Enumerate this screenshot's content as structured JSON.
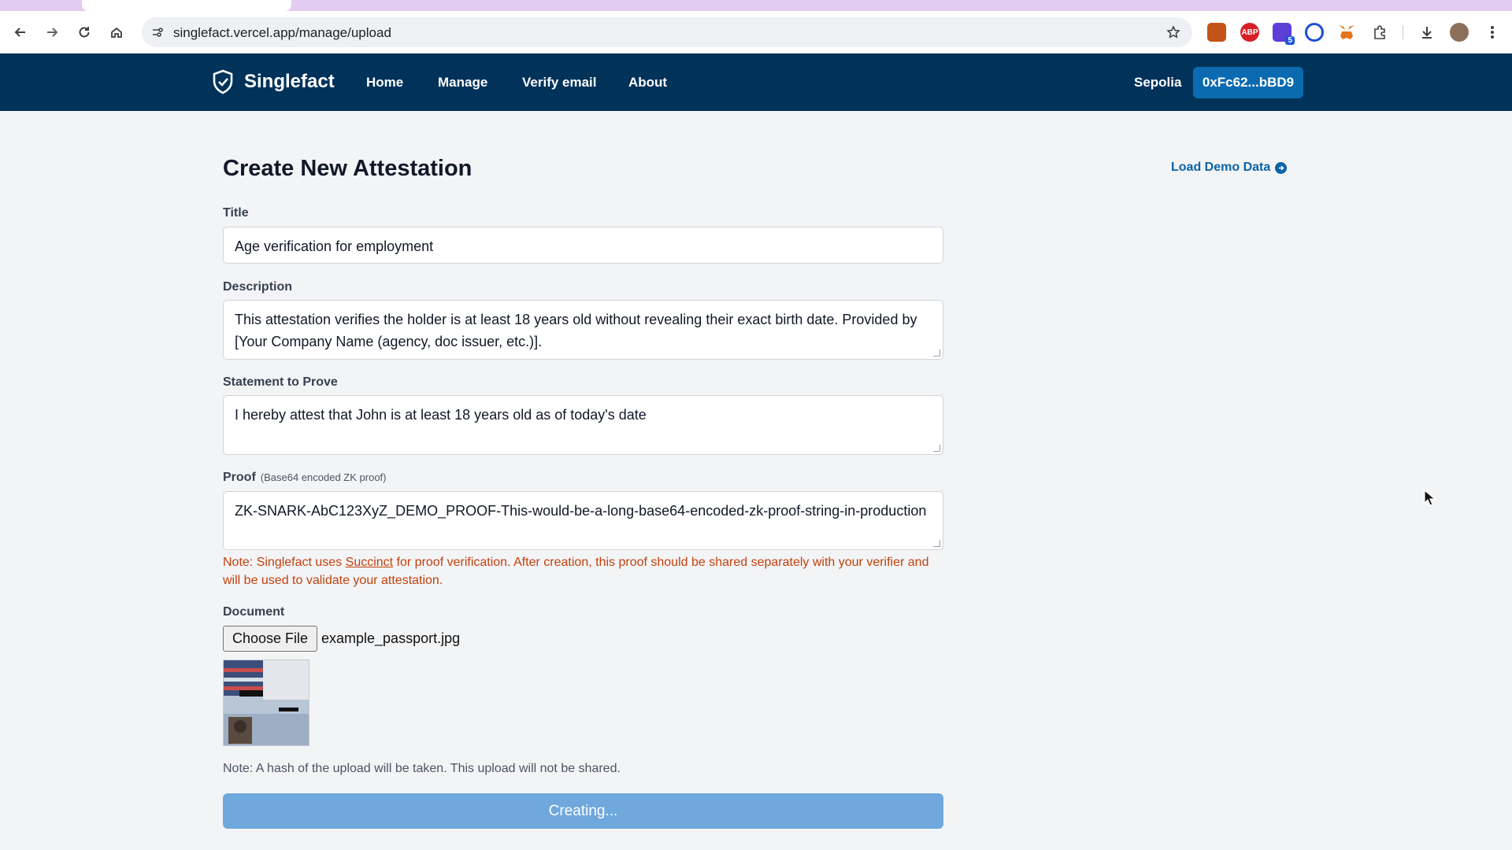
{
  "browser": {
    "url": "singlefact.vercel.app/manage/upload",
    "extensions": [
      {
        "name": "orange-extension-icon",
        "color": "#c2541a",
        "text": ""
      },
      {
        "name": "adblock-plus-icon",
        "color": "#d71f26",
        "text": "ABP"
      },
      {
        "name": "purple-extension-icon",
        "color": "#5b3fd6",
        "text": ""
      },
      {
        "name": "circle-extension-icon",
        "color": "#1a4fd6",
        "text": ""
      },
      {
        "name": "metamask-fox-icon",
        "color": "#e2761b",
        "text": ""
      }
    ],
    "extension_badge": "5"
  },
  "header": {
    "brand": "Singlefact",
    "nav": [
      "Home",
      "Manage",
      "Verify email",
      "About"
    ],
    "network": "Sepolia",
    "wallet": "0xFc62...bBD9"
  },
  "form": {
    "page_title": "Create New Attestation",
    "demo_link": "Load Demo Data",
    "title_label": "Title",
    "title_value": "Age verification for employment",
    "description_label": "Description",
    "description_value": "This attestation verifies the holder is at least 18 years old without revealing their exact birth date. Provided by [Your Company Name (agency, doc issuer, etc.)].",
    "statement_label": "Statement to Prove",
    "statement_value": "I hereby attest that John is at least 18 years old as of today's date",
    "proof_label": "Proof",
    "proof_sublabel": "(Base64 encoded ZK proof)",
    "proof_value": "ZK-SNARK-AbC123XyZ_DEMO_PROOF-This-would-be-a-long-base64-encoded-zk-proof-string-in-production",
    "note_prefix": "Note: Singlefact uses ",
    "note_link": "Succinct",
    "note_suffix": " for proof verification. After creation, this proof should be shared separately with your verifier and will be used to validate your attestation.",
    "document_label": "Document",
    "file_button": "Choose File",
    "file_name": "example_passport.jpg",
    "hash_note": "Note: A hash of the upload will be taken. This upload will not be shared.",
    "submit_label": "Creating..."
  }
}
